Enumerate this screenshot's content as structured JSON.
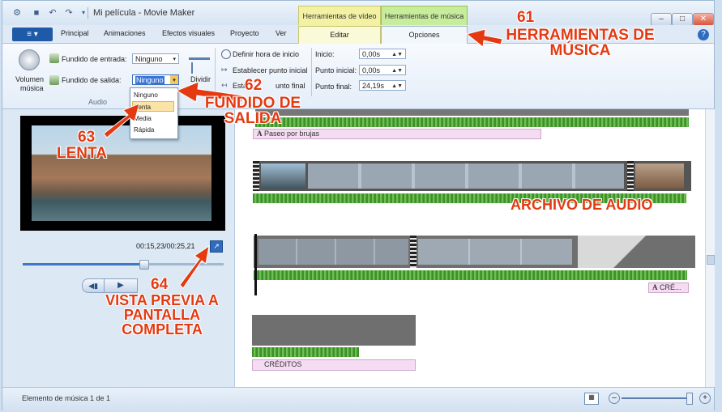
{
  "window": {
    "title": "Mi película - Movie Maker",
    "contextual_tabs": {
      "video": "Herramientas de vídeo",
      "music": "Herramientas de música"
    }
  },
  "tabs": {
    "file_label": "≡ ▾",
    "items": [
      "Principal",
      "Animaciones",
      "Efectos visuales",
      "Proyecto",
      "Ver"
    ],
    "editar": "Editar",
    "opciones": "Opciones"
  },
  "ribbon": {
    "volume_label_1": "Volumen",
    "volume_label_2": "música",
    "fade_in_label": "Fundido de entrada:",
    "fade_in_value": "Ninguno",
    "fade_out_label": "Fundido de salida:",
    "fade_out_value": "Ninguno",
    "split_label": "Dividir",
    "group_audio": "Audio",
    "set_start_time": "Definir hora de inicio",
    "set_start_point": "Establecer punto inicial",
    "set_end_point_a": "Esta",
    "set_end_point_b": "unto final",
    "start_label": "Inicio:",
    "start_value": "0,00s",
    "start_point_label": "Punto inicial:",
    "start_point_value": "0,00s",
    "end_point_label": "Punto final:",
    "end_point_value": "24,19s"
  },
  "fade_dropdown": {
    "options": [
      "Ninguno",
      "Lenta",
      "Media",
      "Rápida"
    ],
    "highlighted": "Lenta"
  },
  "preview": {
    "time": "00:15,23/00:25,21",
    "progress_fraction": 0.6
  },
  "timeline": {
    "caption_1": "Paseo por brujas",
    "caption_credits_small": "CRÉ...",
    "credits": "CRÉDITOS"
  },
  "status": {
    "text": "Elemento de música 1 de 1"
  },
  "annotations": {
    "a61_num": "61",
    "a61_text": "HERRAMIENTAS DE MÚSICA",
    "a62_num": "62",
    "a62_text": "FUNDIDO DE SALIDA",
    "a63_num": "63",
    "a63_text": "LENTA",
    "a64_num": "64",
    "a64_text": "VISTA PREVIA A PANTALLA COMPLETA",
    "audio_file": "ARCHIVO DE AUDIO"
  },
  "colors": {
    "annotation": "#e33a12",
    "audio_wave": "#4da238",
    "music_tab": "#c6ec9c",
    "video_tab": "#f3f1a4"
  }
}
